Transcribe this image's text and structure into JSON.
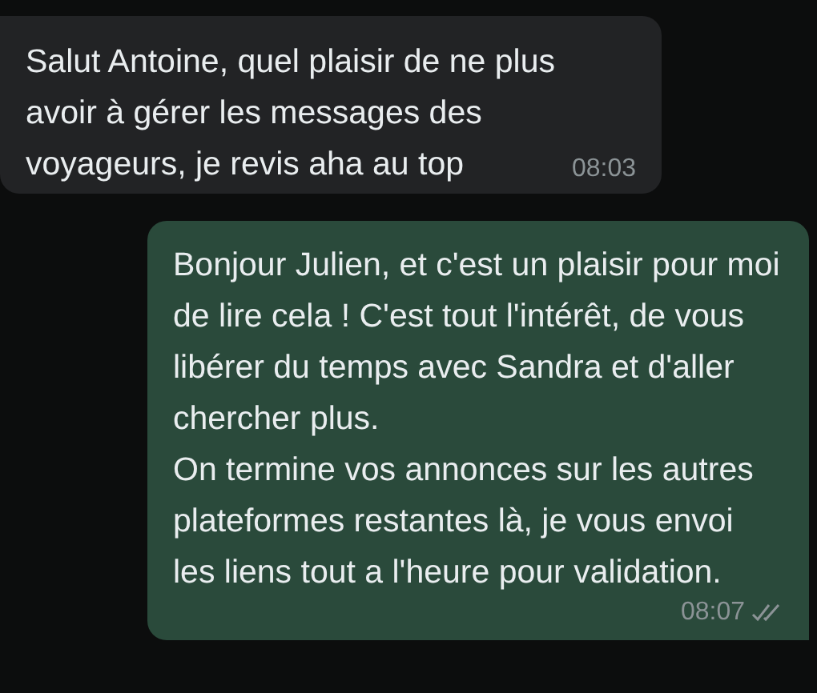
{
  "messages": [
    {
      "kind": "incoming",
      "text": "Salut Antoine, quel plaisir de ne plus avoir à gérer les messages des voyageurs, je revis aha au top",
      "time": "08:03"
    },
    {
      "kind": "outgoing",
      "text": "Bonjour Julien, et c'est un plaisir pour moi de lire cela ! C'est tout l'intérêt, de vous libérer du temps avec Sandra et d'aller chercher plus.\nOn termine vos annonces sur les autres plateformes restantes là, je vous envoi les liens tout a l'heure pour validation.",
      "time": "08:07",
      "read": false
    }
  ]
}
